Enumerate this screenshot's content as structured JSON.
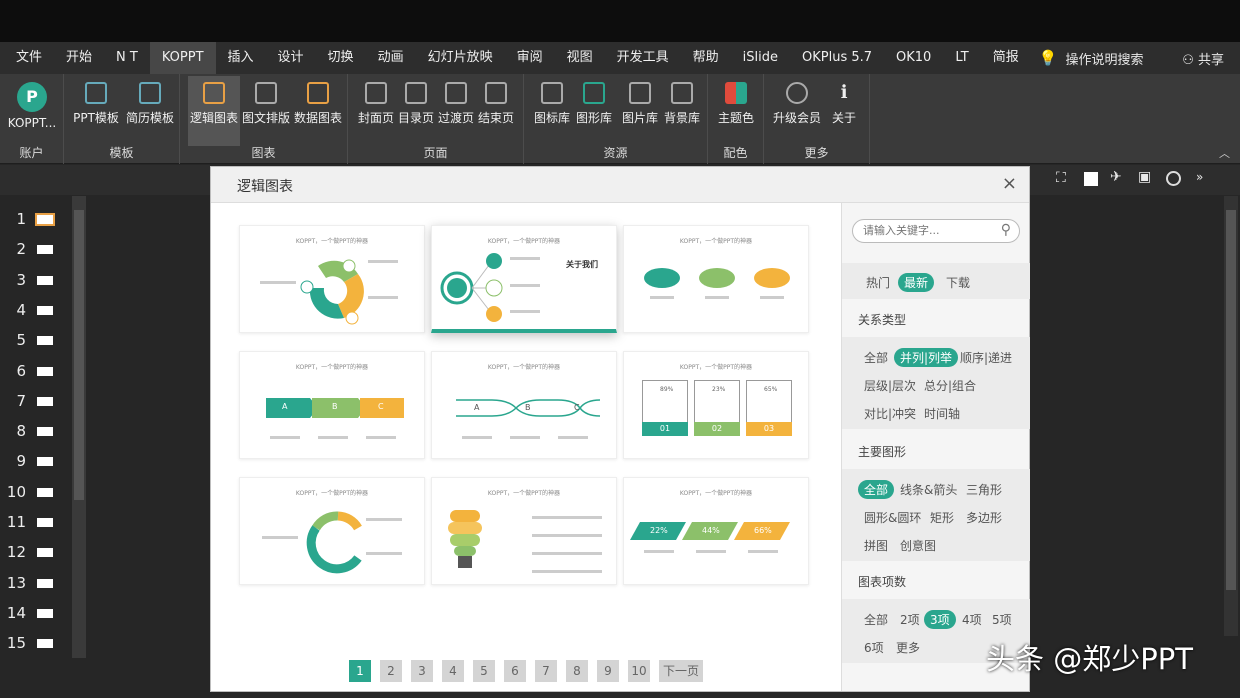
{
  "menu": {
    "tabs": [
      "文件",
      "开始",
      "N T",
      "KOPPT",
      "插入",
      "设计",
      "切换",
      "动画",
      "幻灯片放映",
      "审阅",
      "视图",
      "开发工具",
      "帮助",
      "iSlide",
      "OKPlus 5.7",
      "OK10",
      "LT",
      "简报"
    ],
    "active": "KOPPT",
    "help": "操作说明搜索",
    "share": "共享"
  },
  "ribbon": {
    "account": {
      "label": "KOPPT...",
      "group": "账户"
    },
    "template": {
      "items": [
        "PPT模板",
        "简历模板"
      ],
      "group": "模板"
    },
    "chart": {
      "items": [
        "逻辑图表",
        "图文排版",
        "数据图表"
      ],
      "group": "图表"
    },
    "page": {
      "items": [
        "封面页",
        "目录页",
        "过渡页",
        "结束页"
      ],
      "group": "页面"
    },
    "resource": {
      "items": [
        "图标库",
        "图形库",
        "图片库",
        "背景库"
      ],
      "group": "资源"
    },
    "color": {
      "items": [
        "主题色"
      ],
      "group": "配色"
    },
    "more": {
      "items": [
        "升级会员",
        "关于"
      ],
      "group": "更多"
    }
  },
  "slides": [
    "1",
    "2",
    "3",
    "4",
    "5",
    "6",
    "7",
    "8",
    "9",
    "10",
    "11",
    "12",
    "13",
    "14",
    "15"
  ],
  "dialog": {
    "title": "逻辑图表",
    "close": "×"
  },
  "cards": [
    {
      "caption": "KOPPT，一个做PPT的神器"
    },
    {
      "caption": "KOPPT，一个做PPT的神器",
      "extra": "关于我们"
    },
    {
      "caption": "KOPPT，一个做PPT的神器"
    },
    {
      "caption": "KOPPT，一个做PPT的神器",
      "letters": [
        "A",
        "B",
        "C"
      ]
    },
    {
      "caption": "KOPPT，一个做PPT的神器",
      "letters": [
        "A",
        "B",
        "C"
      ]
    },
    {
      "caption": "KOPPT，一个做PPT的神器",
      "nums": [
        "01",
        "02",
        "03"
      ],
      "pcts": [
        "89%",
        "23%",
        "65%"
      ]
    },
    {
      "caption": "KOPPT，一个做PPT的神器"
    },
    {
      "caption": "KOPPT，一个做PPT的神器"
    },
    {
      "caption": "KOPPT，一个做PPT的神器",
      "pcts": [
        "22%",
        "44%",
        "66%"
      ]
    }
  ],
  "pager": {
    "pages": [
      "1",
      "2",
      "3",
      "4",
      "5",
      "6",
      "7",
      "8",
      "9",
      "10"
    ],
    "current": "1",
    "next": "下一页"
  },
  "sidebar": {
    "search_placeholder": "请输入关键字...",
    "sort": [
      "热门",
      "最新",
      "下载"
    ],
    "sort_active": "最新",
    "relation": {
      "title": "关系类型",
      "items": [
        "全部",
        "并列|列举",
        "顺序|递进",
        "层级|层次",
        "总分|组合",
        "对比|冲突",
        "时间轴"
      ],
      "active": "并列|列举"
    },
    "shape": {
      "title": "主要图形",
      "items": [
        "全部",
        "线条&箭头",
        "三角形",
        "圆形&圆环",
        "矩形",
        "多边形",
        "拼图",
        "创意图"
      ],
      "active": "全部"
    },
    "count": {
      "title": "图表项数",
      "items": [
        "全部",
        "2项",
        "3项",
        "4项",
        "5项",
        "6项",
        "更多"
      ],
      "active": "3项"
    }
  },
  "watermark": "头条 @郑少PPT",
  "colors": {
    "accent": "#2aa68e",
    "green": "#8cc06a",
    "yellow": "#f3b33d"
  }
}
